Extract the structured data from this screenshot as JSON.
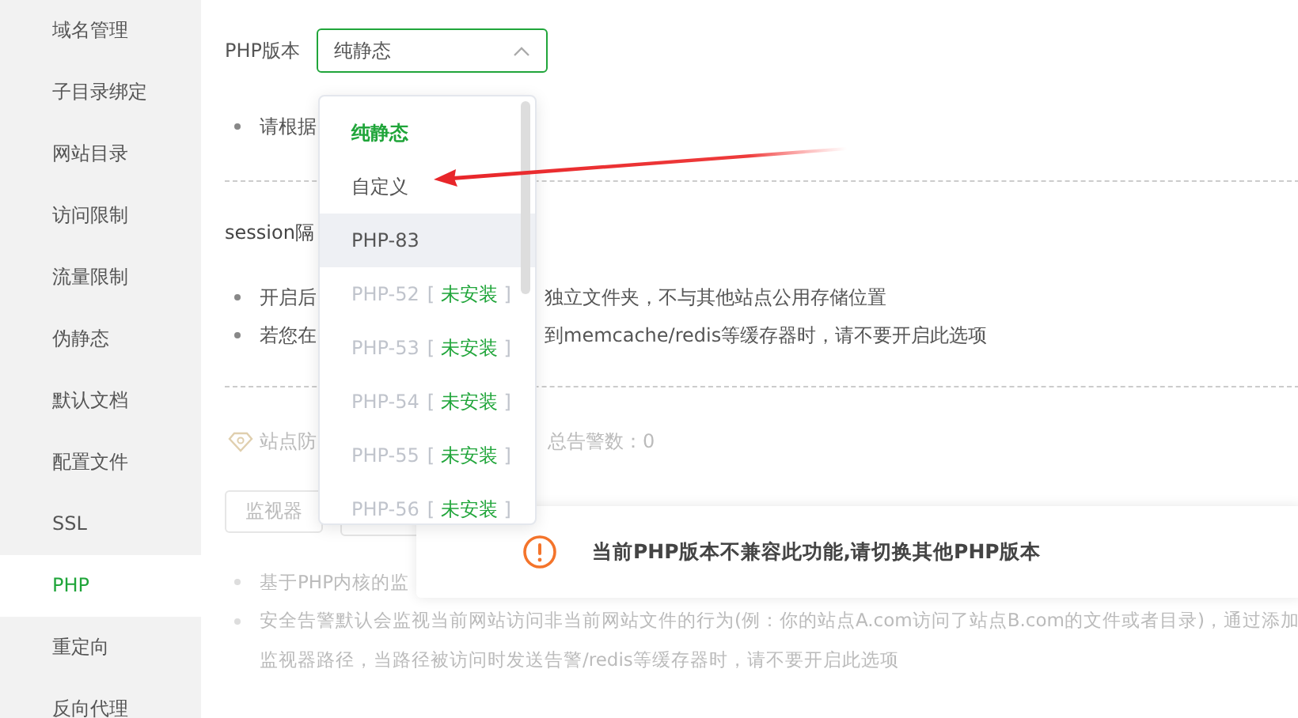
{
  "sidebar": {
    "items": [
      {
        "label": "域名管理",
        "selected": false
      },
      {
        "label": "子目录绑定",
        "selected": false
      },
      {
        "label": "网站目录",
        "selected": false
      },
      {
        "label": "访问限制",
        "selected": false
      },
      {
        "label": "流量限制",
        "selected": false
      },
      {
        "label": "伪静态",
        "selected": false
      },
      {
        "label": "默认文档",
        "selected": false
      },
      {
        "label": "配置文件",
        "selected": false
      },
      {
        "label": "SSL",
        "selected": false
      },
      {
        "label": "PHP",
        "selected": true
      },
      {
        "label": "重定向",
        "selected": false
      },
      {
        "label": "反向代理",
        "selected": false
      }
    ]
  },
  "php_version": {
    "label": "PHP版本",
    "value": "纯静态",
    "expanded": true
  },
  "dropdown": {
    "options": [
      {
        "label": "纯静态",
        "selected": true,
        "highlighted": false,
        "disabled": false
      },
      {
        "label": "自定义",
        "selected": false,
        "highlighted": false,
        "disabled": false
      },
      {
        "label": "PHP-83",
        "selected": false,
        "highlighted": true,
        "disabled": false
      },
      {
        "label": "PHP-52",
        "selected": false,
        "highlighted": false,
        "disabled": true,
        "prefix": "[",
        "status": "未安装",
        "suffix": "]"
      },
      {
        "label": "PHP-53",
        "selected": false,
        "highlighted": false,
        "disabled": true,
        "prefix": "[",
        "status": "未安装",
        "suffix": "]"
      },
      {
        "label": "PHP-54",
        "selected": false,
        "highlighted": false,
        "disabled": true,
        "prefix": "[",
        "status": "未安装",
        "suffix": "]"
      },
      {
        "label": "PHP-55",
        "selected": false,
        "highlighted": false,
        "disabled": true,
        "prefix": "[",
        "status": "未安装",
        "suffix": "]"
      },
      {
        "label": "PHP-56",
        "selected": false,
        "highlighted": false,
        "disabled": true,
        "prefix": "[",
        "status": "未安装",
        "suffix": "]"
      }
    ]
  },
  "version_note": "请根据",
  "session": {
    "title": "session隔",
    "notes": [
      {
        "left": "开启后",
        "right": "独立文件夹，不与其他站点公用存储位置"
      },
      {
        "left": "若您在",
        "right": "到memcache/redis等缓存器时，请不要开启此选项"
      }
    ]
  },
  "alarm": {
    "label": "站点防",
    "total": "总告警数：0",
    "button": "监视器",
    "notes": [
      "基于PHP内核的监",
      "安全告警默认会监视当前网站访问非当前网站文件的行为(例：你的站点A.com访问了站点B.com的文件或者目录)，通过添加",
      "监视器路径，当路径被访问时发送告警/redis等缓存器时，请不要开启此选项"
    ]
  },
  "toast": {
    "message": "当前PHP版本不兼容此功能,请切换其他PHP版本"
  }
}
